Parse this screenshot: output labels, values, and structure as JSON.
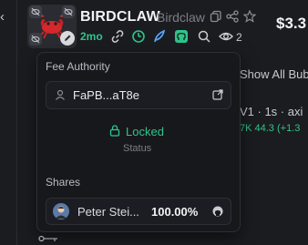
{
  "token": {
    "name": "BIRDCLAW",
    "symbol": "Birdclaw",
    "price": "$3.3",
    "age": "2mo",
    "holders_count": "2"
  },
  "background": {
    "bubble_text": "Show All Bub",
    "pair_text": "V1 · 1s · axi",
    "stats_text": "7K 44.3 (+1.3"
  },
  "popover": {
    "fee_authority_label": "Fee Authority",
    "fee_address": "FaPB...aT8e",
    "lock_state": "Locked",
    "lock_caption": "Status",
    "shares_label": "Shares",
    "shares": [
      {
        "name": "Peter Stei...",
        "percent": "100.00%"
      }
    ]
  },
  "colors": {
    "accent_green": "#2fc58a",
    "background": "#1b1c20",
    "panel": "#17181c"
  }
}
